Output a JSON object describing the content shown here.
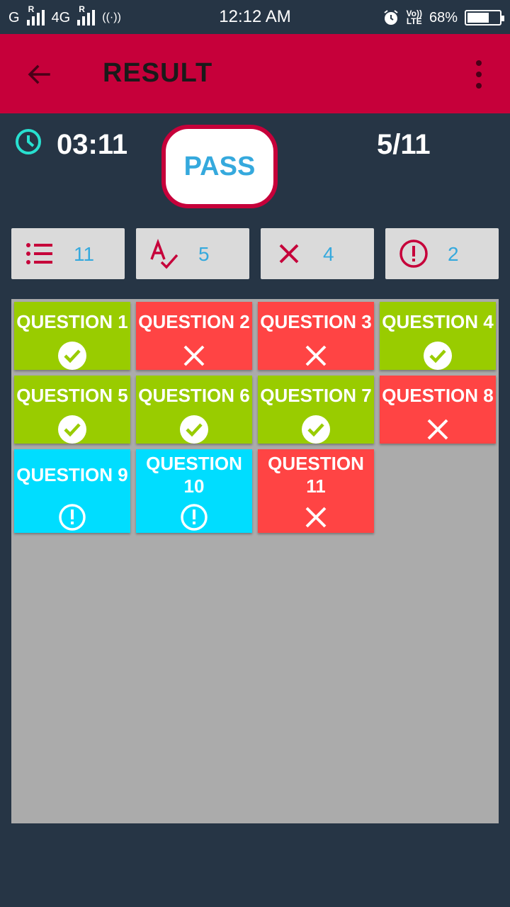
{
  "status_bar": {
    "carrier1": "G",
    "carrier2": "4G",
    "time": "12:12 AM",
    "volte_top": "Vo))",
    "volte_bottom": "LTE",
    "battery_text": "68%",
    "battery_level": 0.68
  },
  "app_bar": {
    "title": "RESULT"
  },
  "summary": {
    "time_taken": "03:11",
    "result": "PASS",
    "score": "5/11"
  },
  "stats": [
    {
      "icon": "list-icon",
      "value": "11"
    },
    {
      "icon": "spellcheck-icon",
      "value": "5"
    },
    {
      "icon": "close-icon",
      "value": "4"
    },
    {
      "icon": "alert-circle-icon",
      "value": "2"
    }
  ],
  "questions": [
    {
      "label": "QUESTION 1",
      "status": "correct"
    },
    {
      "label": "QUESTION 2",
      "status": "wrong"
    },
    {
      "label": "QUESTION 3",
      "status": "wrong"
    },
    {
      "label": "QUESTION 4",
      "status": "correct"
    },
    {
      "label": "QUESTION 5",
      "status": "correct"
    },
    {
      "label": "QUESTION 6",
      "status": "correct"
    },
    {
      "label": "QUESTION 7",
      "status": "correct"
    },
    {
      "label": "QUESTION 8",
      "status": "wrong"
    },
    {
      "label": "QUESTION 9",
      "status": "unanswered"
    },
    {
      "label": "QUESTION 10",
      "status": "unanswered"
    },
    {
      "label": "QUESTION 11",
      "status": "wrong"
    }
  ],
  "colors": {
    "app_bar": "#c6003a",
    "background": "#263545",
    "correct": "#99cc00",
    "wrong": "#ff4444",
    "unanswered": "#00ddff",
    "stat_value": "#35a9dd"
  }
}
